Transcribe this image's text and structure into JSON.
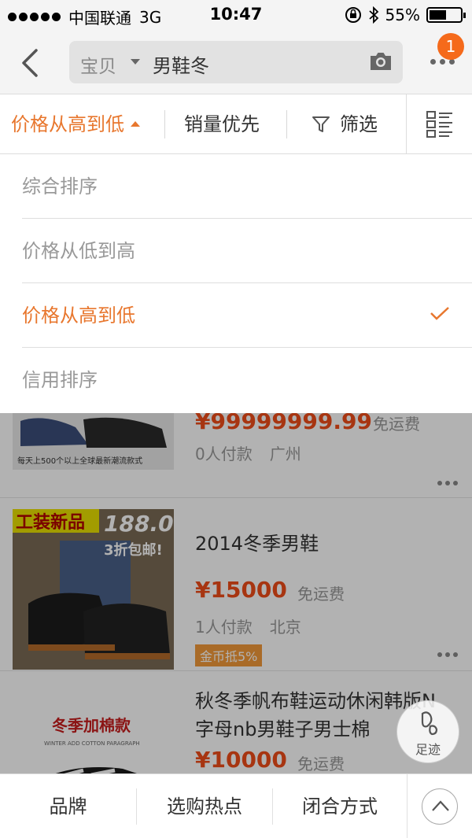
{
  "status_bar": {
    "carrier": "中国联通",
    "network": "3G",
    "time": "10:47",
    "battery": "55%",
    "battery_level": 0.55
  },
  "nav": {
    "back_icon": "chevron-left-icon",
    "search_scope": "宝贝",
    "search_query": "男鞋冬",
    "camera_icon": "camera-icon",
    "more_icon": "more-dots-icon",
    "badge_count": "1",
    "badge_color": "#f56a1b"
  },
  "sort_bar": {
    "active": "价格从高到低",
    "sales": "销量优先",
    "filter": "筛选",
    "accent_color": "#e8772e"
  },
  "dropdown": {
    "options": [
      {
        "label": "综合排序",
        "selected": false
      },
      {
        "label": "价格从低到高",
        "selected": false
      },
      {
        "label": "价格从高到低",
        "selected": true
      },
      {
        "label": "信用排序",
        "selected": false
      }
    ]
  },
  "products": [
    {
      "image_text": "每天上500个以上全球最新潮流款式",
      "price": "¥99999999.99",
      "shipping": "免运费",
      "buyers": "0人付款",
      "location": "广州"
    },
    {
      "image_banner": "工装新品",
      "image_price": "188.0",
      "image_promo": "3折包邮!",
      "title": "2014冬季男鞋",
      "price": "¥15000",
      "shipping": "免运费",
      "buyers": "1人付款",
      "location": "北京",
      "tag": "金币抵5%"
    },
    {
      "image_banner": "冬季加棉款",
      "image_sub": "WINTER ADD COTTON PARAGRAPH",
      "title": "秋冬季帆布鞋运动休闲韩版N字母nb男鞋子男士棉",
      "price": "¥10000",
      "shipping": "免运费"
    }
  ],
  "footprint": {
    "label": "足迹"
  },
  "bottom_bar": {
    "items": [
      "品牌",
      "选购热点",
      "闭合方式"
    ],
    "up_icon": "chevron-up-icon"
  }
}
